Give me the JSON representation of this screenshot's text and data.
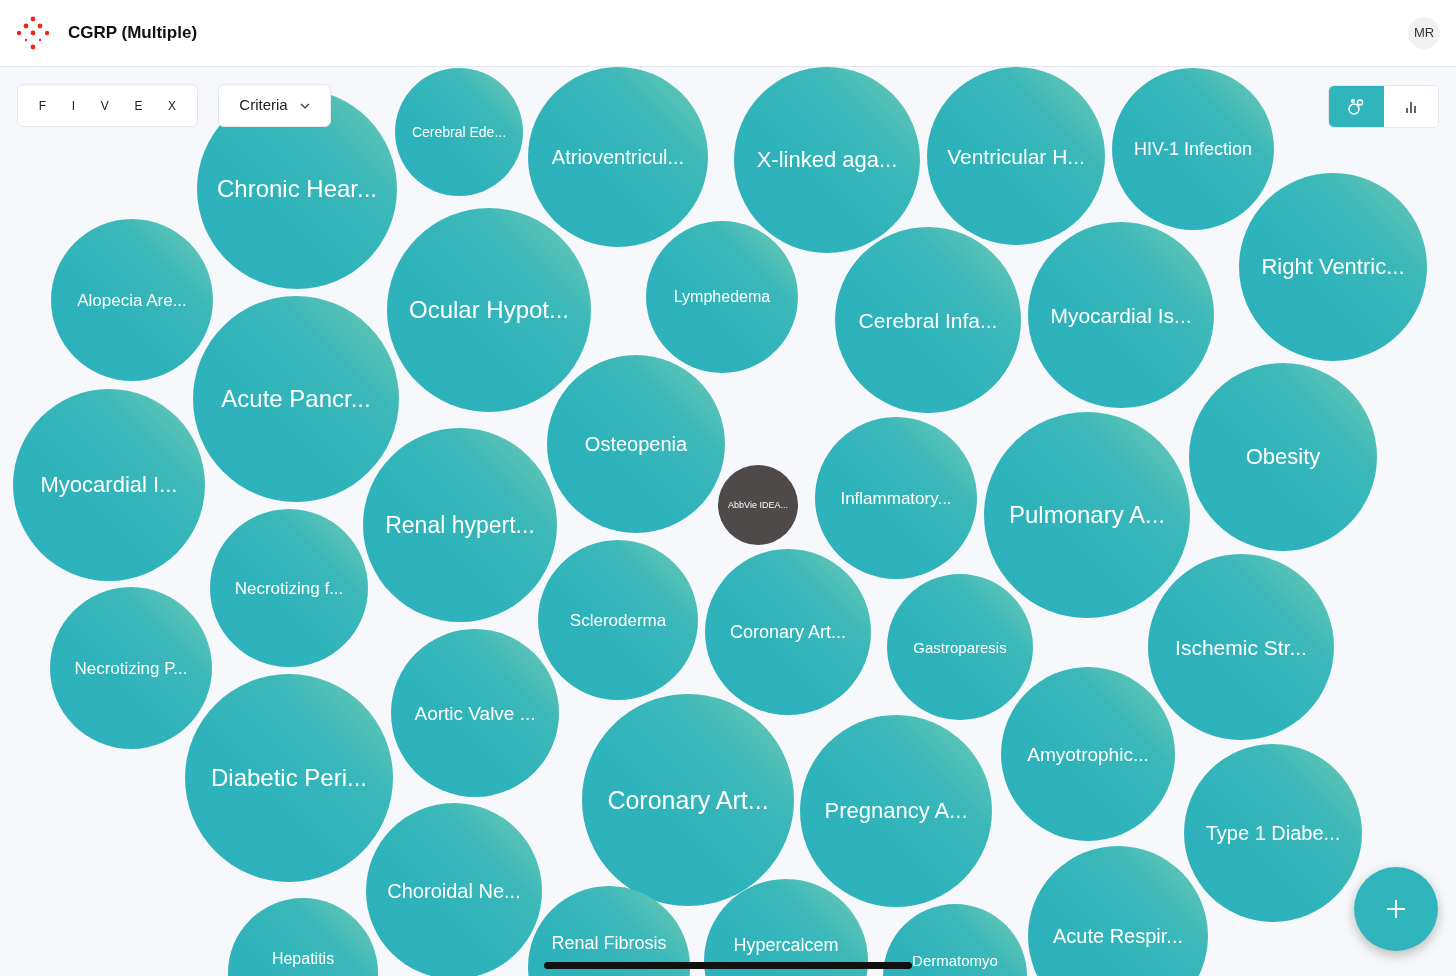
{
  "header": {
    "title": "CGRP (Multiple)",
    "avatar": "MR"
  },
  "filter_letters": [
    "F",
    "I",
    "V",
    "E",
    "X"
  ],
  "criteria": {
    "label": "Criteria"
  },
  "view_toggle": [
    {
      "kind": "bubbles",
      "selected": true
    },
    {
      "kind": "bars",
      "selected": false
    }
  ],
  "bubbles": [
    {
      "label": "Chronic Hear...",
      "kind": "condition"
    },
    {
      "label": "Cerebral Ede...",
      "kind": "condition"
    },
    {
      "label": "Atrioventricul...",
      "kind": "condition"
    },
    {
      "label": "X-linked aga...",
      "kind": "condition"
    },
    {
      "label": "Ventricular H...",
      "kind": "condition"
    },
    {
      "label": "HIV-1 Infection",
      "kind": "condition"
    },
    {
      "label": "Right Ventric...",
      "kind": "condition"
    },
    {
      "label": "Alopecia Are...",
      "kind": "condition"
    },
    {
      "label": "Ocular Hypot...",
      "kind": "condition"
    },
    {
      "label": "Lymphedema",
      "kind": "condition"
    },
    {
      "label": "Cerebral Infa...",
      "kind": "condition"
    },
    {
      "label": "Myocardial Is...",
      "kind": "condition"
    },
    {
      "label": "Acute Pancr...",
      "kind": "condition"
    },
    {
      "label": "Osteopenia",
      "kind": "condition"
    },
    {
      "label": "Obesity",
      "kind": "condition"
    },
    {
      "label": "Myocardial I...",
      "kind": "condition"
    },
    {
      "label": "AbbVie IDEA...",
      "kind": "sponsor"
    },
    {
      "label": "Inflammatory...",
      "kind": "condition"
    },
    {
      "label": "Renal hypert...",
      "kind": "condition"
    },
    {
      "label": "Pulmonary A...",
      "kind": "condition"
    },
    {
      "label": "Necrotizing f...",
      "kind": "condition"
    },
    {
      "label": "Scleroderma",
      "kind": "condition"
    },
    {
      "label": "Coronary Art...",
      "kind": "condition"
    },
    {
      "label": "Gastroparesis",
      "kind": "condition"
    },
    {
      "label": "Ischemic Str...",
      "kind": "condition"
    },
    {
      "label": "Necrotizing P...",
      "kind": "condition"
    },
    {
      "label": "Aortic Valve ...",
      "kind": "condition"
    },
    {
      "label": "Diabetic Peri...",
      "kind": "condition"
    },
    {
      "label": "Coronary Art...",
      "kind": "condition"
    },
    {
      "label": "Pregnancy A...",
      "kind": "condition"
    },
    {
      "label": "Amyotrophic...",
      "kind": "condition"
    },
    {
      "label": "Type 1 Diabe...",
      "kind": "condition"
    },
    {
      "label": "Choroidal Ne...",
      "kind": "condition"
    },
    {
      "label": "Acute Respir...",
      "kind": "condition"
    },
    {
      "label": "Hepatitis",
      "kind": "condition"
    },
    {
      "label": "Renal Fibrosis",
      "kind": "condition"
    },
    {
      "label": "Hypercalcem",
      "kind": "condition"
    },
    {
      "label": "Dermatomyo",
      "kind": "condition"
    }
  ]
}
